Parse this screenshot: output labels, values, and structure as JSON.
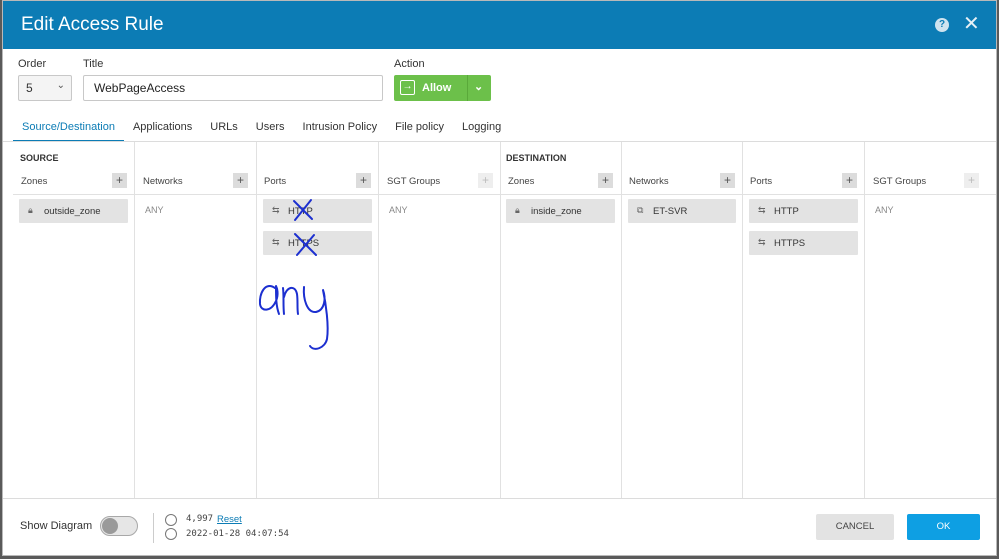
{
  "dialog": {
    "title": "Edit Access Rule",
    "help_icon": "help-circle-icon",
    "close_icon": "close-x-icon"
  },
  "form": {
    "order_label": "Order",
    "order_value": "5",
    "title_label": "Title",
    "title_value": "WebPageAccess",
    "action_label": "Action",
    "action_value": "Allow",
    "action_color": "#6cc04a"
  },
  "tabs": [
    {
      "label": "Source/Destination",
      "active": true
    },
    {
      "label": "Applications"
    },
    {
      "label": "URLs"
    },
    {
      "label": "Users"
    },
    {
      "label": "Intrusion Policy"
    },
    {
      "label": "File policy"
    },
    {
      "label": "Logging"
    }
  ],
  "source": {
    "heading": "SOURCE",
    "zones": {
      "label": "Zones",
      "items": [
        "outside_zone"
      ]
    },
    "networks": {
      "label": "Networks",
      "any": "ANY"
    },
    "ports": {
      "label": "Ports",
      "items": [
        "HTTP",
        "HTTPS"
      ]
    },
    "sgt": {
      "label": "SGT Groups",
      "any": "ANY"
    }
  },
  "destination": {
    "heading": "DESTINATION",
    "zones": {
      "label": "Zones",
      "items": [
        "inside_zone"
      ]
    },
    "networks": {
      "label": "Networks",
      "items": [
        "ET-SVR"
      ]
    },
    "ports": {
      "label": "Ports",
      "items": [
        "HTTP",
        "HTTPS"
      ]
    },
    "sgt": {
      "label": "SGT Groups",
      "any": "ANY"
    }
  },
  "add_symbol": "+",
  "footer": {
    "show_diagram_label": "Show Diagram",
    "show_diagram_on": false,
    "hit_count": "4,997",
    "reset_label": "Reset",
    "last_hit": "2022-01-28 04:07:54",
    "cancel_label": "CANCEL",
    "ok_label": "OK"
  },
  "annotation": {
    "handwritten_text": "any",
    "ink_color": "#1c2fd0"
  },
  "colors": {
    "header": "#0c7cb5",
    "accent": "#0e9fe3"
  }
}
